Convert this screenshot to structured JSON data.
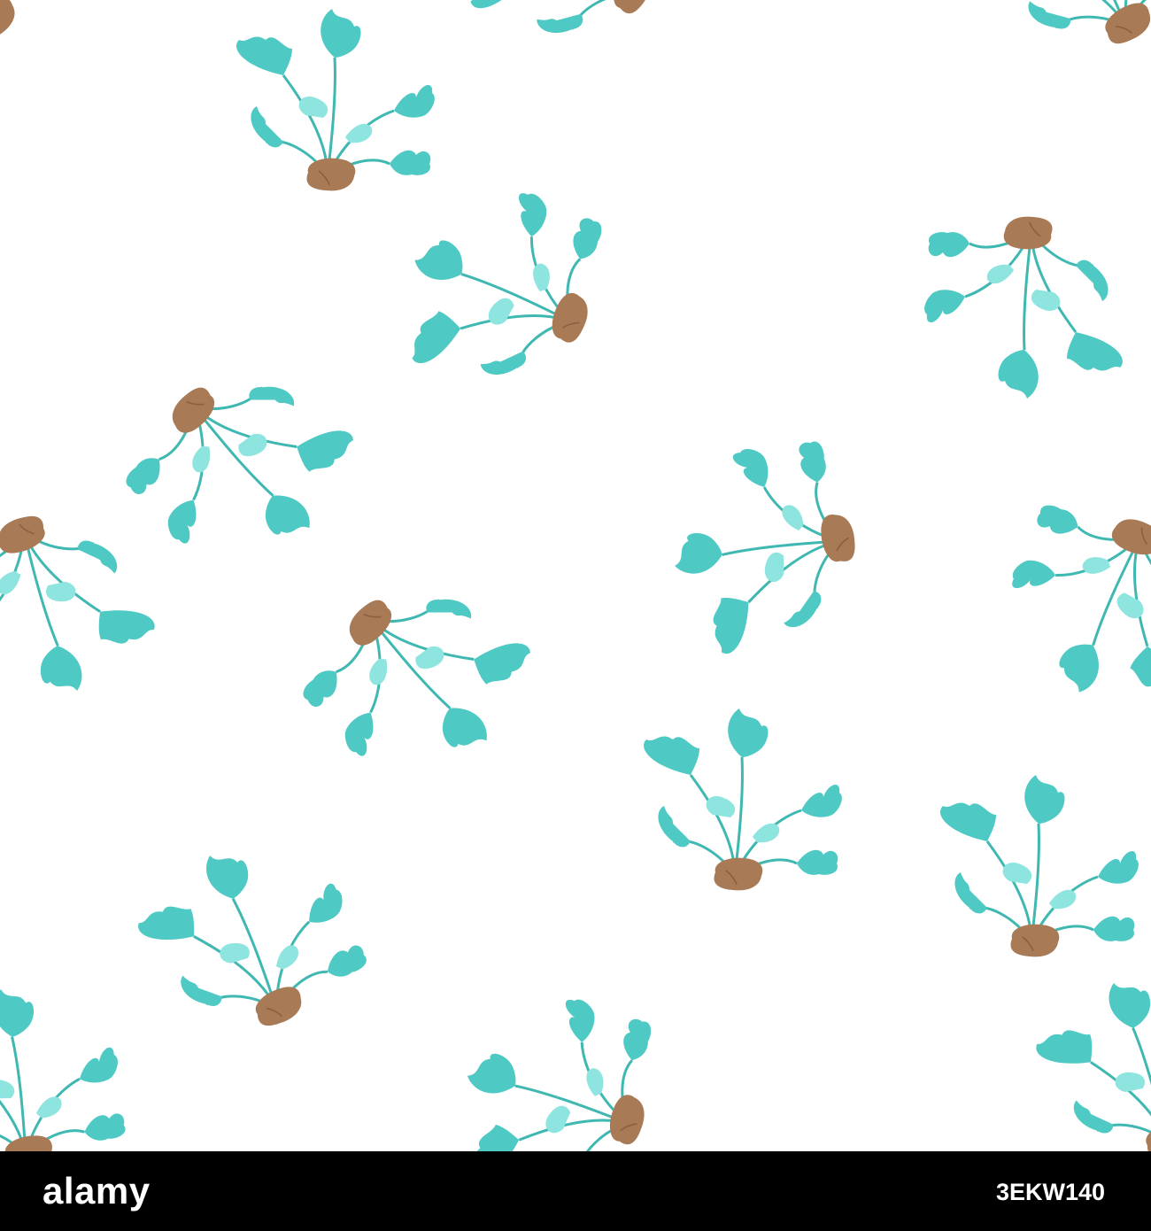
{
  "colors": {
    "background": "#ffffff",
    "leaf": "#4ec9c4",
    "leaf_light": "#8ee4df",
    "stem": "#3fb8b2",
    "root": "#a87a56",
    "footer": "#000000",
    "footer_text": "#ffffff"
  },
  "pattern": {
    "motif": "beet-plant-icon"
  },
  "footer": {
    "logo": "alamy",
    "image_id": "3EKW140"
  }
}
